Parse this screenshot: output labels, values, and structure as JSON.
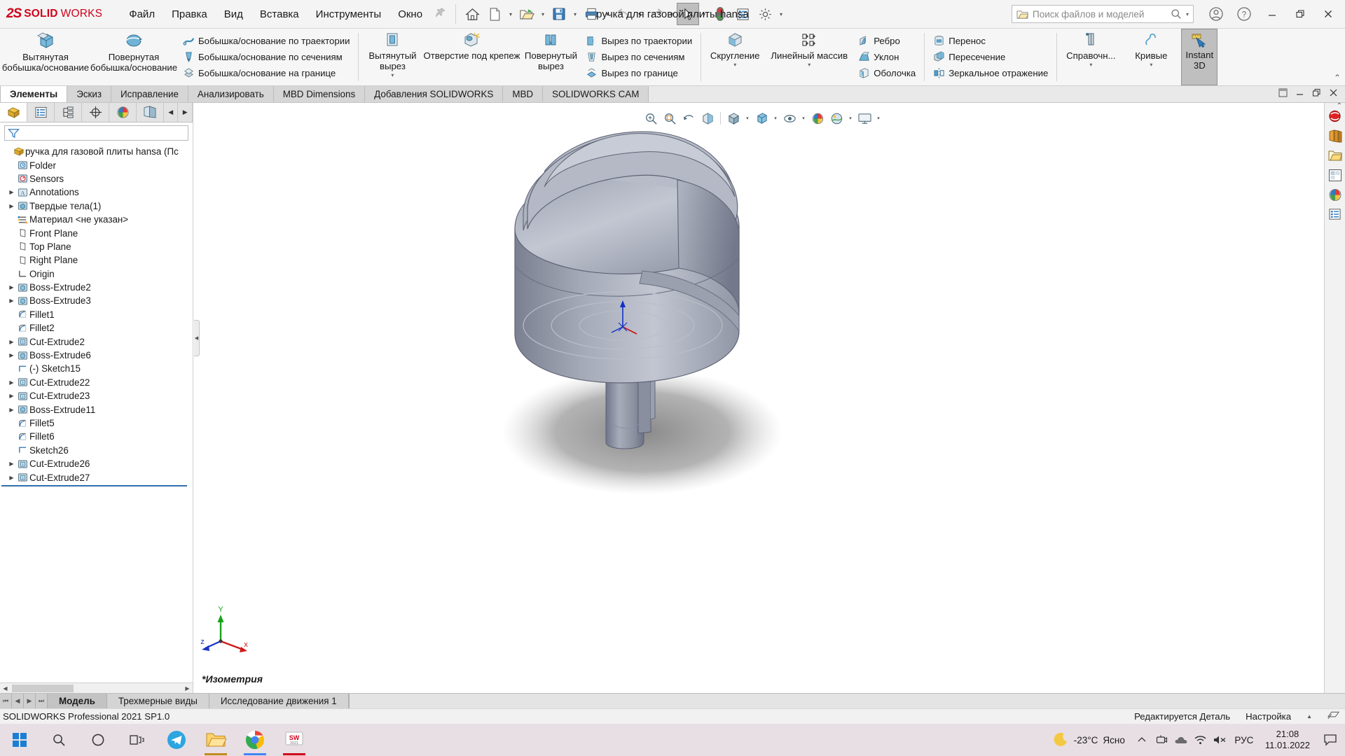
{
  "app": {
    "brand_ds": "2S",
    "brand_solid": "SOLID",
    "brand_works": "WORKS",
    "document_title": "ручка для газовой плиты hansa",
    "accent_red": "#d0021b"
  },
  "menubar": {
    "items": [
      {
        "label": "Файл",
        "name": "menu-file"
      },
      {
        "label": "Правка",
        "name": "menu-edit"
      },
      {
        "label": "Вид",
        "name": "menu-view"
      },
      {
        "label": "Вставка",
        "name": "menu-insert"
      },
      {
        "label": "Инструменты",
        "name": "menu-tools"
      },
      {
        "label": "Окно",
        "name": "menu-window"
      }
    ]
  },
  "quick_access": {
    "buttons": [
      {
        "icon": "home-icon",
        "name": "qat-home"
      },
      {
        "icon": "new-document-icon",
        "name": "qat-new"
      },
      {
        "icon": "open-folder-icon",
        "name": "qat-open"
      },
      {
        "icon": "save-icon",
        "name": "qat-save"
      },
      {
        "icon": "print-icon",
        "name": "qat-print"
      },
      {
        "icon": "undo-icon",
        "name": "qat-undo"
      },
      {
        "icon": "redo-icon",
        "name": "qat-redo"
      },
      {
        "icon": "select-cursor-icon",
        "name": "qat-select"
      },
      {
        "icon": "rebuild-traffic-light-icon",
        "name": "qat-rebuild"
      },
      {
        "icon": "options-list-icon",
        "name": "qat-file-properties"
      },
      {
        "icon": "gear-icon",
        "name": "qat-options"
      }
    ]
  },
  "search": {
    "placeholder": "Поиск файлов и моделей"
  },
  "window_controls": {
    "minimize": "—",
    "restore": "❐",
    "close": "✕"
  },
  "ribbon": {
    "groups": [
      {
        "name": "features-boss",
        "big": [
          {
            "label": "Вытянутая\nбобышка/основание",
            "icon": "extruded-boss-icon",
            "name": "ribbon-extruded-boss"
          },
          {
            "label": "Повернутая\nбобышка/основание",
            "icon": "revolved-boss-icon",
            "name": "ribbon-revolved-boss"
          }
        ],
        "small": [
          {
            "label": "Бобышка/основание по траектории",
            "icon": "swept-boss-icon",
            "name": "ribbon-swept-boss"
          },
          {
            "label": "Бобышка/основание по сечениям",
            "icon": "lofted-boss-icon",
            "name": "ribbon-lofted-boss"
          },
          {
            "label": "Бобышка/основание на границе",
            "icon": "boundary-boss-icon",
            "name": "ribbon-boundary-boss"
          }
        ]
      },
      {
        "name": "features-cut",
        "big": [
          {
            "label": "Вытянутый\nвырез",
            "icon": "extruded-cut-icon",
            "name": "ribbon-extruded-cut",
            "dropdown": true
          },
          {
            "label": "Отверстие под крепеж",
            "icon": "hole-wizard-icon",
            "name": "ribbon-hole-wizard"
          },
          {
            "label": "Повернутый\nвырез",
            "icon": "revolved-cut-icon",
            "name": "ribbon-revolved-cut"
          }
        ],
        "small": [
          {
            "label": "Вырез по траектории",
            "icon": "swept-cut-icon",
            "name": "ribbon-swept-cut"
          },
          {
            "label": "Вырез по сечениям",
            "icon": "lofted-cut-icon",
            "name": "ribbon-lofted-cut"
          },
          {
            "label": "Вырез по границе",
            "icon": "boundary-cut-icon",
            "name": "ribbon-boundary-cut"
          }
        ]
      },
      {
        "name": "features-modify",
        "big": [
          {
            "label": "Скругление",
            "icon": "fillet-icon",
            "name": "ribbon-fillet",
            "dropdown": true
          },
          {
            "label": "Линейный массив",
            "icon": "linear-pattern-icon",
            "name": "ribbon-linear-pattern",
            "dropdown": true
          }
        ],
        "small": [
          {
            "label": "Ребро",
            "icon": "rib-icon",
            "name": "ribbon-rib"
          },
          {
            "label": "Уклон",
            "icon": "draft-icon",
            "name": "ribbon-draft"
          },
          {
            "label": "Оболочка",
            "icon": "shell-icon",
            "name": "ribbon-shell"
          }
        ]
      },
      {
        "name": "features-transform",
        "small": [
          {
            "label": "Перенос",
            "icon": "move-body-icon",
            "name": "ribbon-move-body"
          },
          {
            "label": "Пересечение",
            "icon": "intersect-icon",
            "name": "ribbon-intersect"
          },
          {
            "label": "Зеркальное отражение",
            "icon": "mirror-icon",
            "name": "ribbon-mirror"
          }
        ]
      },
      {
        "name": "features-reference",
        "big": [
          {
            "label": "Справочн...",
            "icon": "reference-geometry-icon",
            "name": "ribbon-reference-geometry",
            "dropdown": true
          },
          {
            "label": "Кривые",
            "icon": "curves-icon",
            "name": "ribbon-curves",
            "dropdown": true
          },
          {
            "label": "Instant\n3D",
            "icon": "instant3d-icon",
            "name": "ribbon-instant-3d",
            "selected": true
          }
        ]
      }
    ],
    "collapse_glyph": "⌃"
  },
  "command_tabs": {
    "items": [
      {
        "label": "Элементы",
        "active": true,
        "name": "tab-features"
      },
      {
        "label": "Эскиз",
        "active": false,
        "name": "tab-sketch"
      },
      {
        "label": "Исправление",
        "active": false,
        "name": "tab-markup"
      },
      {
        "label": "Анализировать",
        "active": false,
        "name": "tab-evaluate"
      },
      {
        "label": "MBD Dimensions",
        "active": false,
        "name": "tab-mbd-dimensions"
      },
      {
        "label": "Добавления SOLIDWORKS",
        "active": false,
        "name": "tab-solidworks-addins"
      },
      {
        "label": "MBD",
        "active": false,
        "name": "tab-mbd"
      },
      {
        "label": "SOLIDWORKS CAM",
        "active": false,
        "name": "tab-solidworks-cam"
      }
    ],
    "right_controls": [
      "restore-window-icon",
      "minimize-window-icon",
      "maximize-window-icon",
      "close-window-icon"
    ]
  },
  "feature_manager": {
    "tabs": [
      {
        "icon": "feature-tree-icon",
        "active": true,
        "name": "fm-tab-feature-tree"
      },
      {
        "icon": "property-manager-icon",
        "active": false,
        "name": "fm-tab-property-manager"
      },
      {
        "icon": "configuration-manager-icon",
        "active": false,
        "name": "fm-tab-configuration-manager"
      },
      {
        "icon": "dimxpert-icon",
        "active": false,
        "name": "fm-tab-dimxpert"
      },
      {
        "icon": "display-manager-icon",
        "active": false,
        "name": "fm-tab-display-manager"
      },
      {
        "icon": "cam-tree-icon",
        "active": false,
        "name": "fm-tab-cam-tree"
      }
    ],
    "filter_icon": "filter-funnel-icon",
    "root": {
      "label": "ручка для газовой плиты hansa  (Пс",
      "icon": "part-icon"
    },
    "nodes": [
      {
        "label": "Folder",
        "icon": "history-folder-icon",
        "expand": false,
        "indent": 1
      },
      {
        "label": "Sensors",
        "icon": "sensors-icon",
        "expand": false,
        "indent": 1
      },
      {
        "label": "Annotations",
        "icon": "annotations-icon",
        "expand": true,
        "indent": 1
      },
      {
        "label": "Твердые тела(1)",
        "icon": "solid-bodies-icon",
        "expand": true,
        "indent": 1
      },
      {
        "label": "Материал <не указан>",
        "icon": "material-icon",
        "expand": false,
        "indent": 1
      },
      {
        "label": "Front Plane",
        "icon": "plane-icon",
        "expand": false,
        "indent": 1
      },
      {
        "label": "Top Plane",
        "icon": "plane-icon",
        "expand": false,
        "indent": 1
      },
      {
        "label": "Right Plane",
        "icon": "plane-icon",
        "expand": false,
        "indent": 1
      },
      {
        "label": "Origin",
        "icon": "origin-icon",
        "expand": false,
        "indent": 1
      },
      {
        "label": "Boss-Extrude2",
        "icon": "boss-extrude-icon",
        "expand": true,
        "indent": 1
      },
      {
        "label": "Boss-Extrude3",
        "icon": "boss-extrude-icon",
        "expand": true,
        "indent": 1
      },
      {
        "label": "Fillet1",
        "icon": "fillet-feature-icon",
        "expand": false,
        "indent": 1
      },
      {
        "label": "Fillet2",
        "icon": "fillet-feature-icon",
        "expand": false,
        "indent": 1
      },
      {
        "label": "Cut-Extrude2",
        "icon": "cut-extrude-icon",
        "expand": true,
        "indent": 1
      },
      {
        "label": "Boss-Extrude6",
        "icon": "boss-extrude-icon",
        "expand": true,
        "indent": 1
      },
      {
        "label": "(-) Sketch15",
        "icon": "sketch-icon",
        "expand": false,
        "indent": 1
      },
      {
        "label": "Cut-Extrude22",
        "icon": "cut-extrude-icon",
        "expand": true,
        "indent": 1
      },
      {
        "label": "Cut-Extrude23",
        "icon": "cut-extrude-icon",
        "expand": true,
        "indent": 1
      },
      {
        "label": "Boss-Extrude11",
        "icon": "boss-extrude-icon",
        "expand": true,
        "indent": 1
      },
      {
        "label": "Fillet5",
        "icon": "fillet-feature-icon",
        "expand": false,
        "indent": 1
      },
      {
        "label": "Fillet6",
        "icon": "fillet-feature-icon",
        "expand": false,
        "indent": 1
      },
      {
        "label": "Sketch26",
        "icon": "sketch-icon",
        "expand": false,
        "indent": 1
      },
      {
        "label": "Cut-Extrude26",
        "icon": "cut-extrude-icon",
        "expand": true,
        "indent": 1
      },
      {
        "label": "Cut-Extrude27",
        "icon": "cut-extrude-icon",
        "expand": true,
        "indent": 1
      }
    ]
  },
  "graphics": {
    "view_label": "*Изометрия",
    "triad": {
      "x": "x",
      "y": "Y",
      "z": "z"
    },
    "view_toolbar": [
      {
        "icon": "zoom-to-fit-icon",
        "name": "view-zoom-to-fit"
      },
      {
        "icon": "zoom-to-area-icon",
        "name": "view-zoom-to-area"
      },
      {
        "icon": "previous-view-icon",
        "name": "view-previous"
      },
      {
        "icon": "section-view-icon",
        "name": "view-section"
      },
      {
        "icon": "view-orientation-icon",
        "name": "view-orientation"
      },
      {
        "icon": "display-style-icon",
        "name": "view-display-style"
      },
      {
        "icon": "hide-show-items-icon",
        "name": "view-hide-show"
      },
      {
        "icon": "appearances-icon",
        "name": "view-appearances"
      },
      {
        "icon": "scene-icon",
        "name": "view-scene"
      },
      {
        "icon": "view-settings-icon",
        "name": "view-settings"
      }
    ]
  },
  "task_pane": {
    "buttons": [
      {
        "icon": "solidworks-resources-icon",
        "name": "taskpane-resources"
      },
      {
        "icon": "design-library-icon",
        "name": "taskpane-design-library"
      },
      {
        "icon": "file-explorer-icon",
        "name": "taskpane-file-explorer"
      },
      {
        "icon": "view-palette-icon",
        "name": "taskpane-view-palette"
      },
      {
        "icon": "appearances-scenes-icon",
        "name": "taskpane-appearances"
      },
      {
        "icon": "custom-properties-icon",
        "name": "taskpane-custom-properties"
      }
    ]
  },
  "document_tabs": {
    "nav": [
      "⏮",
      "◀",
      "▶",
      "⏭"
    ],
    "items": [
      {
        "label": "Модель",
        "active": true,
        "name": "doctab-model"
      },
      {
        "label": "Трехмерные виды",
        "active": false,
        "name": "doctab-3d-views"
      },
      {
        "label": "Исследование движения 1",
        "active": false,
        "name": "doctab-motion-study"
      }
    ]
  },
  "status_bar": {
    "version": "SOLIDWORKS Professional 2021 SP1.0",
    "edit_state": "Редактируется Деталь",
    "settings": "Настройка"
  },
  "taskbar": {
    "buttons": [
      {
        "icon": "windows-start-icon",
        "name": "taskbar-start"
      },
      {
        "icon": "search-icon",
        "name": "taskbar-search"
      },
      {
        "icon": "cortana-circle-icon",
        "name": "taskbar-cortana"
      },
      {
        "icon": "task-view-icon",
        "name": "taskbar-task-view"
      },
      {
        "icon": "telegram-icon",
        "name": "taskbar-telegram"
      },
      {
        "icon": "file-explorer-icon",
        "name": "taskbar-explorer"
      },
      {
        "icon": "chrome-icon",
        "name": "taskbar-chrome"
      },
      {
        "icon": "solidworks-app-icon",
        "name": "taskbar-solidworks"
      }
    ],
    "tray": {
      "weather_icon": "moon-icon",
      "temperature": "-23°C",
      "condition": "Ясно",
      "chevron": "⌃",
      "icons": [
        "screen-cast-icon",
        "onedrive-cloud-icon",
        "wifi-icon",
        "volume-muted-icon"
      ],
      "language": "РУС",
      "time": "21:08",
      "date": "11.01.2022",
      "notification_icon": "notification-icon"
    }
  }
}
